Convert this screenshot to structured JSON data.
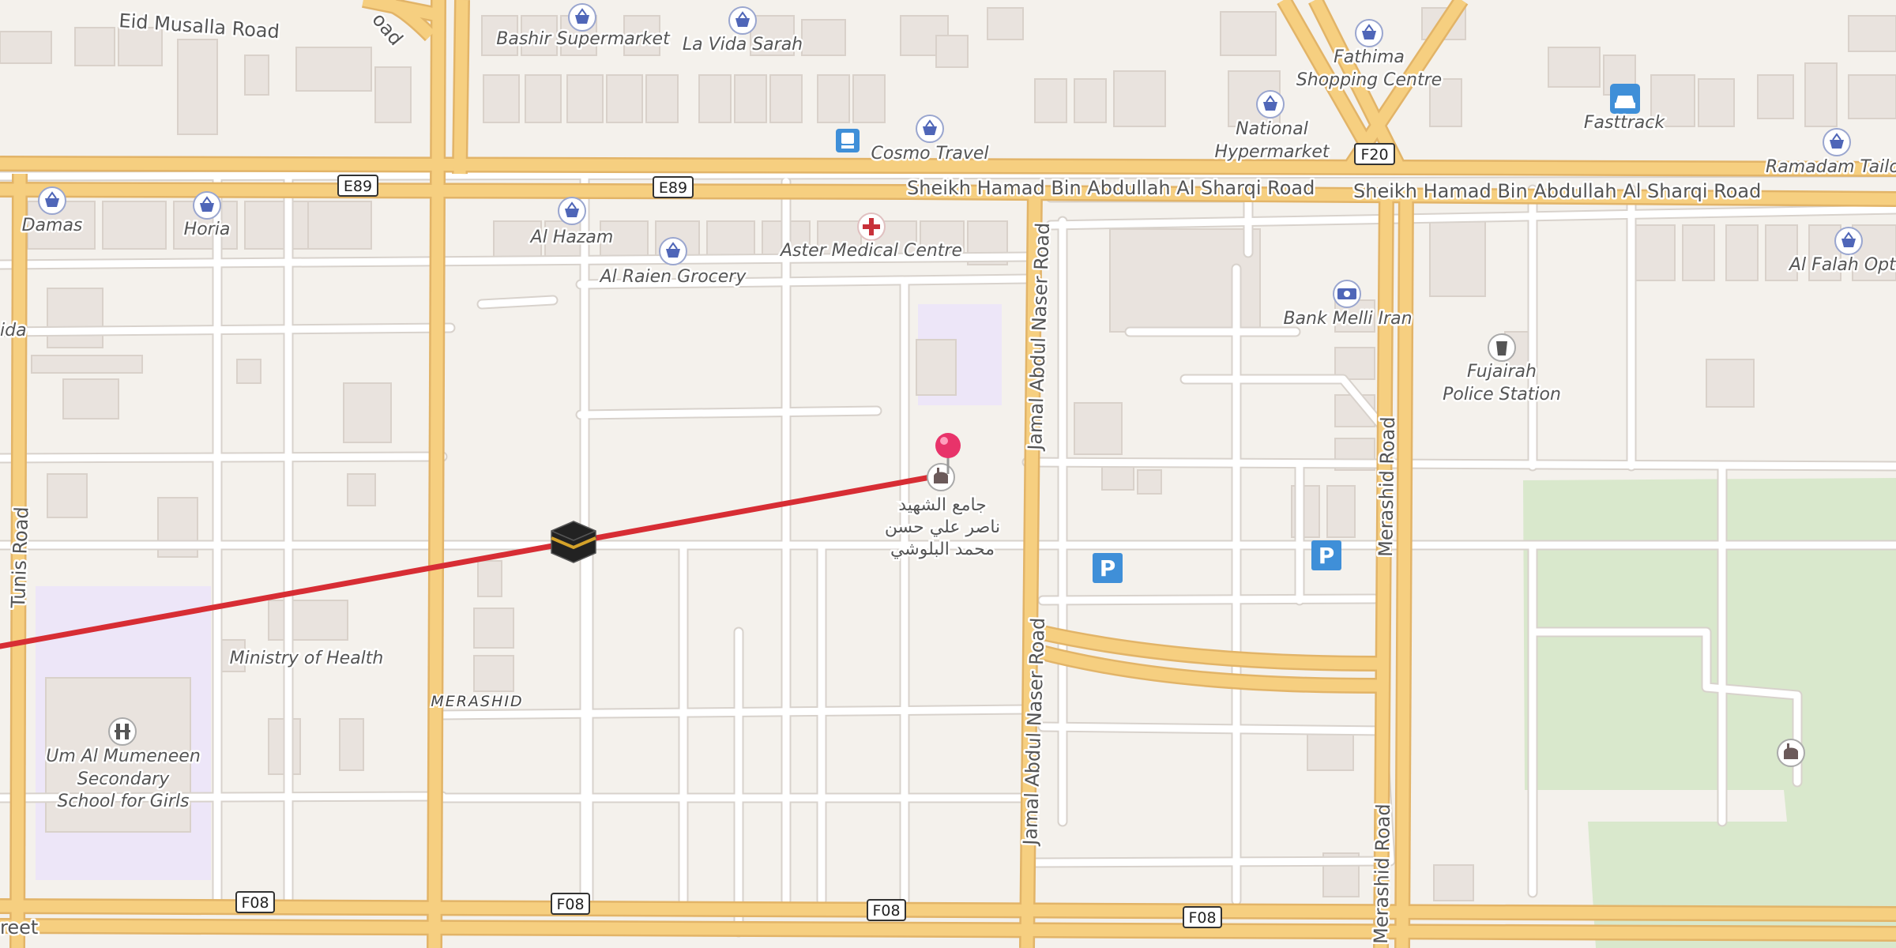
{
  "colors": {
    "land": "#f4f1ec",
    "building": "#e9e3de",
    "building_edge": "#d9d1ca",
    "major_road": "#f6cf80",
    "major_road_edge": "#e2b468",
    "minor_road": "#ffffff",
    "minor_road_edge": "#d8d2cc",
    "park": "#d9e8cc",
    "school_area": "#ede6f8",
    "route": "#d72d34",
    "pin": "#e8336a",
    "poi_icon": "#4f66b8",
    "parking": "#3f8fd8"
  },
  "streets": {
    "eid_musalla": "Eid Musalla Road",
    "sheikh_hamad_1": "Sheikh Hamad Bin Abdullah Al Sharqi Road",
    "sheikh_hamad_2": "Sheikh Hamad Bin Abdullah Al Sharqi Road",
    "jamal_north": "Jamal Abdul Naser Road",
    "jamal_south": "Jamal Abdul Naser Road",
    "merashid_north": "Merashid Road",
    "merashid_south": "Merashid Road",
    "tunis": "Tunis Road",
    "street_sw": "reet",
    "road_nw_fragment": "oad"
  },
  "shields": {
    "e89_left": "E89",
    "e89_mid": "E89",
    "f20": "F20",
    "f08_1": "F08",
    "f08_2": "F08",
    "f08_3": "F08",
    "f08_4": "F08"
  },
  "pois": {
    "bashir": "Bashir Supermarket",
    "la_vida": "La Vida Sarah",
    "fathima_1": "Fathima",
    "fathima_2": "Shopping Centre",
    "fasttrack": "Fasttrack",
    "national_1": "National",
    "national_2": "Hypermarket",
    "cosmo": "Cosmo Travel",
    "ramadam": "Ramadam Tailor",
    "damas": "Damas",
    "horia": "Horia",
    "al_hazam": "Al Hazam",
    "aster": "Aster Medical Centre",
    "al_raien": "Al Raien Grocery",
    "bank_melli": "Bank Melli Iran",
    "police_1": "Fujairah",
    "police_2": "Police Station",
    "al_falah": "Al Falah Optic",
    "ida": "ida",
    "ministry": "Ministry of Health",
    "school_1": "Um Al Mumeneen",
    "school_2": "Secondary",
    "school_3": "School for Girls",
    "merashid_district": "MERASHID",
    "mosque_1": "جامع الشهيد",
    "mosque_2": "ناصر علي حسن",
    "mosque_3": "محمد البلوشي"
  },
  "icons": {
    "pin": "location-pin-icon",
    "kaaba": "kaaba-icon",
    "shop": "shopping-basket-icon",
    "medical": "medical-cross-icon",
    "bus": "bus-stop-icon",
    "car": "car-rental-icon",
    "bank": "bank-icon",
    "police": "police-icon",
    "school": "school-icon",
    "mosque": "mosque-icon",
    "parking": "parking-icon",
    "parking_text": "P"
  }
}
